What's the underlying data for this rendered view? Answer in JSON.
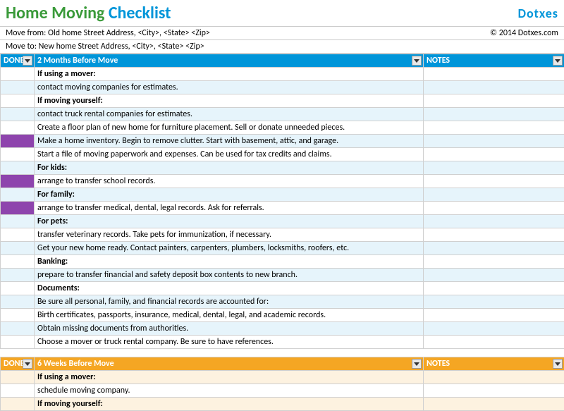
{
  "header": {
    "title_part1": "Home Moving ",
    "title_part2": "Checklist",
    "logo": "Dotxes",
    "copyright": "© 2014 Dotxes.com"
  },
  "move_from": "Move from: Old home Street Address, <City>, <State> <Zip>",
  "move_to": "Move to: New home Street Address, <City>, <State> <Zip>",
  "columns": {
    "done": "DONE",
    "notes": "NOTES"
  },
  "sections": [
    {
      "title": "2 Months Before Move",
      "theme": "blue",
      "rows": [
        {
          "text": "If using a mover:",
          "bold": true,
          "done": false
        },
        {
          "text": "contact moving companies for estimates.",
          "bold": false,
          "done": false
        },
        {
          "text": "If moving yourself:",
          "bold": true,
          "done": false
        },
        {
          "text": "contact truck rental companies for estimates.",
          "bold": false,
          "done": false
        },
        {
          "text": "Create a floor plan of new home for furniture placement. Sell or donate unneeded pieces.",
          "bold": false,
          "done": false
        },
        {
          "text": "Make a home inventory. Begin to remove clutter. Start with basement, attic, and garage.",
          "bold": false,
          "done": true
        },
        {
          "text": "Start a file of moving paperwork and expenses. Can be used for tax credits and claims.",
          "bold": false,
          "done": false
        },
        {
          "text": "For kids:",
          "bold": true,
          "done": false
        },
        {
          "text": "arrange to transfer school records.",
          "bold": false,
          "done": true
        },
        {
          "text": "For family:",
          "bold": true,
          "done": false
        },
        {
          "text": "arrange to transfer medical, dental, legal records. Ask for referrals.",
          "bold": false,
          "done": true
        },
        {
          "text": "For pets:",
          "bold": true,
          "done": false
        },
        {
          "text": "transfer veterinary records. Take pets for immunization, if necessary.",
          "bold": false,
          "done": false
        },
        {
          "text": "Get your new home ready. Contact painters, carpenters, plumbers, locksmiths, roofers, etc.",
          "bold": false,
          "done": false
        },
        {
          "text": "Banking:",
          "bold": true,
          "done": false
        },
        {
          "text": "prepare to transfer financial and safety deposit box contents to new branch.",
          "bold": false,
          "done": false
        },
        {
          "text": "Documents:",
          "bold": true,
          "done": false
        },
        {
          "text": "Be sure all personal, family, and financial records are accounted for:",
          "bold": false,
          "done": false
        },
        {
          "text": "Birth certificates, passports, insurance, medical, dental, legal, and academic records.",
          "bold": false,
          "done": false
        },
        {
          "text": "Obtain missing documents from authorities.",
          "bold": false,
          "done": false
        },
        {
          "text": "Choose a mover or truck rental company. Be sure to have references.",
          "bold": false,
          "done": false
        }
      ]
    },
    {
      "title": "6 Weeks Before Move",
      "theme": "orange",
      "rows": [
        {
          "text": "If using a mover:",
          "bold": true,
          "done": false
        },
        {
          "text": "schedule moving company.",
          "bold": false,
          "done": false
        },
        {
          "text": "If moving yourself:",
          "bold": true,
          "done": false
        }
      ]
    }
  ]
}
